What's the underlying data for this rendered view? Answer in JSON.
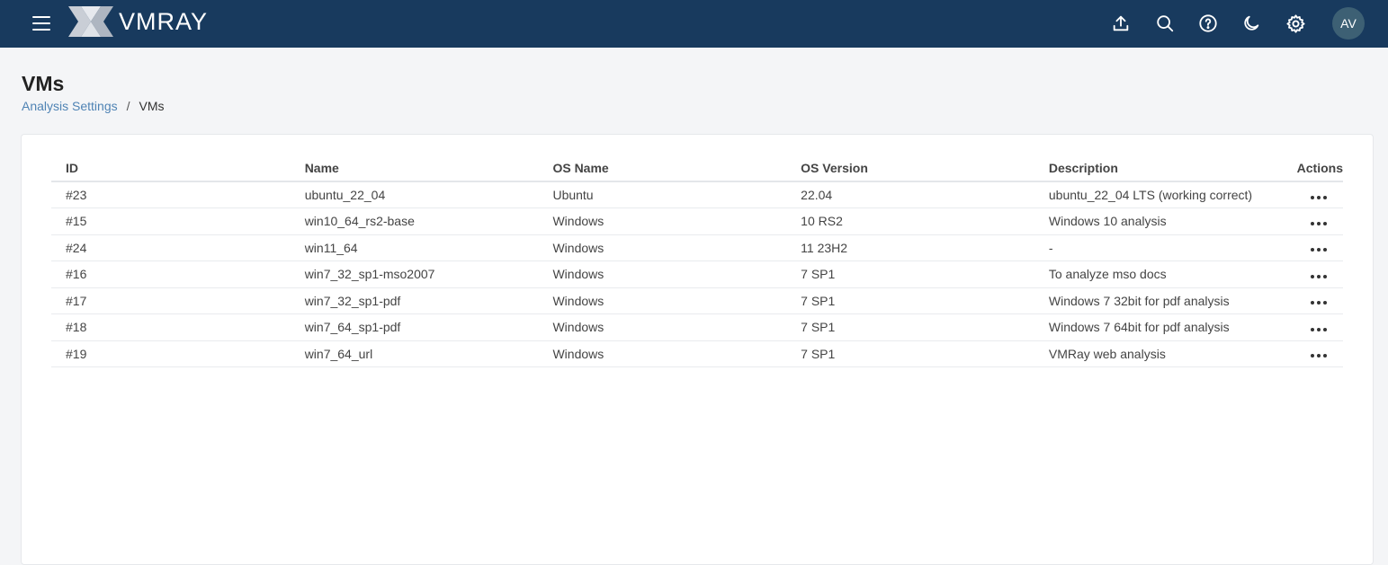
{
  "header": {
    "logo_text": "VMRAY",
    "avatar_initials": "AV",
    "background_color": "#183a5e",
    "icons": [
      "menu-icon",
      "upload-icon",
      "search-icon",
      "help-icon",
      "dark-mode-icon",
      "settings-icon"
    ]
  },
  "page": {
    "title": "VMs",
    "breadcrumb": {
      "parent": "Analysis Settings",
      "separator": "/",
      "current": "VMs"
    }
  },
  "table": {
    "columns": [
      "ID",
      "Name",
      "OS Name",
      "OS Version",
      "Description",
      "Actions"
    ],
    "rows": [
      {
        "id": "#23",
        "name": "ubuntu_22_04",
        "os_name": "Ubuntu",
        "os_version": "22.04",
        "description": "ubuntu_22_04 LTS (working correct)"
      },
      {
        "id": "#15",
        "name": "win10_64_rs2-base",
        "os_name": "Windows",
        "os_version": "10 RS2",
        "description": "Windows 10 analysis"
      },
      {
        "id": "#24",
        "name": "win11_64",
        "os_name": "Windows",
        "os_version": "11 23H2",
        "description": "-"
      },
      {
        "id": "#16",
        "name": "win7_32_sp1-mso2007",
        "os_name": "Windows",
        "os_version": "7 SP1",
        "description": "To analyze mso docs"
      },
      {
        "id": "#17",
        "name": "win7_32_sp1-pdf",
        "os_name": "Windows",
        "os_version": "7 SP1",
        "description": "Windows 7 32bit for pdf analysis"
      },
      {
        "id": "#18",
        "name": "win7_64_sp1-pdf",
        "os_name": "Windows",
        "os_version": "7 SP1",
        "description": "Windows 7 64bit for pdf analysis"
      },
      {
        "id": "#19",
        "name": "win7_64_url",
        "os_name": "Windows",
        "os_version": "7 SP1",
        "description": "VMRay web analysis"
      }
    ]
  }
}
